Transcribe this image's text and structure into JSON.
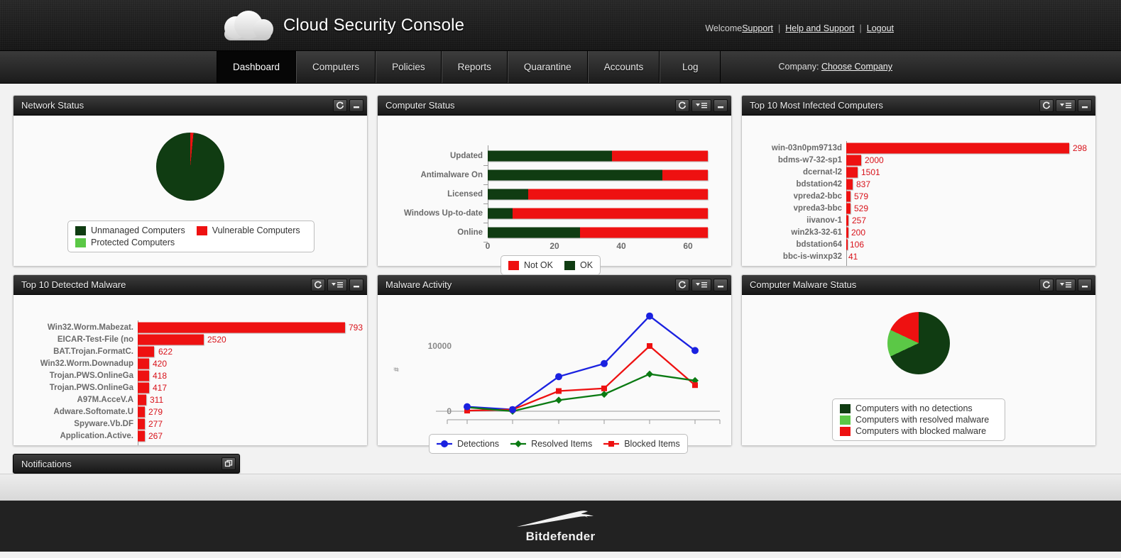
{
  "header": {
    "app_title": "Cloud Security Console",
    "logo_icon": "cloud-icon",
    "welcome_text": "Welcome",
    "user_link": "Support",
    "help_link": "Help and Support",
    "logout_link": "Logout",
    "separator": "|"
  },
  "nav": {
    "tabs": [
      {
        "label": "Dashboard",
        "active": true
      },
      {
        "label": "Computers",
        "active": false
      },
      {
        "label": "Policies",
        "active": false
      },
      {
        "label": "Reports",
        "active": false
      },
      {
        "label": "Quarantine",
        "active": false
      },
      {
        "label": "Accounts",
        "active": false
      },
      {
        "label": "Log",
        "active": false
      }
    ],
    "company_label": "Company:",
    "company_link": "Choose Company"
  },
  "panel_controls": {
    "refresh": "refresh-icon",
    "menu": "dropdown-menu-icon",
    "minimize": "minimize-icon",
    "maximize": "maximize-icon"
  },
  "colors": {
    "dark_green": "#103c12",
    "light_green": "#5bc846",
    "red": "#ee1111",
    "blue": "#1a21e0",
    "green_line": "#0a7a12",
    "axis": "#9a9a9a"
  },
  "panels": {
    "network_status": {
      "title": "Network Status"
    },
    "computer_status": {
      "title": "Computer Status"
    },
    "top_infected": {
      "title": "Top 10 Most Infected Computers"
    },
    "top_malware": {
      "title": "Top 10 Detected Malware"
    },
    "malware_activity": {
      "title": "Malware Activity"
    },
    "computer_malware_status": {
      "title": "Computer Malware Status"
    }
  },
  "notifications": {
    "title": "Notifications",
    "icon": "restore-window-icon"
  },
  "footer": {
    "brand": "Bitdefender",
    "mark": "bitdefender-wolf-icon"
  },
  "chart_data": [
    {
      "id": "network_status",
      "type": "pie",
      "title": "Network Status",
      "labels": [
        "Unmanaged Computers",
        "Vulnerable Computers",
        "Protected Computers"
      ],
      "values": [
        98.5,
        1.5,
        0
      ],
      "colors": [
        "#103c12",
        "#ee1111",
        "#5bc846"
      ],
      "legend": "bottom"
    },
    {
      "id": "computer_status",
      "type": "bar",
      "orientation": "horizontal",
      "stacked": true,
      "title": "Computer Status",
      "categories": [
        "Updated",
        "Antimalware On",
        "Licensed",
        "Windows Up-to-date",
        "Online"
      ],
      "series": [
        {
          "name": "OK",
          "color": "#103c12",
          "values": [
            37,
            52,
            12,
            7.5,
            27.5
          ]
        },
        {
          "name": "Not OK",
          "color": "#ee1111",
          "values": [
            28.6,
            13.6,
            53.6,
            58.1,
            38.1
          ]
        }
      ],
      "xticks": [
        "0",
        "20",
        "40",
        "60"
      ],
      "xtick_values": [
        0,
        20,
        40,
        60
      ],
      "xlim": [
        0,
        65.6
      ],
      "legend": [
        "Not OK",
        "OK"
      ],
      "legend_position": "bottom",
      "grid": false
    },
    {
      "id": "top_infected",
      "type": "bar",
      "orientation": "horizontal",
      "title": "Top 10 Most Infected Computers",
      "categories": [
        "win-03n0pm9713d",
        "bdms-w7-32-sp1",
        "dcernat-l2",
        "bdstation42",
        "vpreda2-bbc",
        "vpreda3-bbc",
        "iivanov-1",
        "win2k3-32-61",
        "bdstation64",
        "bbc-is-winxp32"
      ],
      "values": [
        29800,
        2000,
        1501,
        837,
        579,
        529,
        257,
        200,
        106,
        41
      ],
      "labels": [
        "298",
        "2000",
        "1501",
        "837",
        "579",
        "529",
        "257",
        "200",
        "106",
        "41"
      ],
      "xticks": [
        "0k",
        "5k",
        "10k",
        "15k",
        "20k",
        "25k",
        "30k"
      ],
      "xtick_values": [
        0,
        5000,
        10000,
        15000,
        20000,
        25000,
        30000
      ],
      "xlim": [
        0,
        32500
      ],
      "color": "#ee1111",
      "grid": false
    },
    {
      "id": "top_malware",
      "type": "bar",
      "orientation": "horizontal",
      "title": "Top 10 Detected Malware",
      "categories": [
        "Win32.Worm.Mabezat.",
        "EICAR-Test-File (no",
        "BAT.Trojan.FormatC.",
        "Win32.Worm.Downadup",
        "Trojan.PWS.OnlineGa",
        "Trojan.PWS.OnlineGa",
        "A97M.AcceV.A",
        "Adware.Softomate.U",
        "Spyware.Vb.DF",
        "Application.Active."
      ],
      "values": [
        7930,
        2520,
        622,
        420,
        418,
        417,
        311,
        279,
        277,
        267
      ],
      "labels": [
        "793",
        "2520",
        "622",
        "420",
        "418",
        "417",
        "311",
        "279",
        "277",
        "267"
      ],
      "xticks": [
        "0k",
        "2k",
        "4k",
        "6k",
        "8k"
      ],
      "xtick_values": [
        0,
        2000,
        4000,
        6000,
        8000
      ],
      "xlim": [
        0,
        8600
      ],
      "color": "#ee1111",
      "grid": false
    },
    {
      "id": "malware_activity",
      "type": "line",
      "title": "Malware Activity",
      "ylabel": "#",
      "yticks": [
        "0",
        "10000"
      ],
      "ytick_values": [
        0,
        10000
      ],
      "ylim": [
        0,
        16000
      ],
      "x": [
        1,
        2,
        3,
        4,
        5,
        6
      ],
      "series": [
        {
          "name": "Detections",
          "color": "#1a21e0",
          "marker": "circle",
          "values": [
            700,
            250,
            5300,
            7300,
            14600,
            9300
          ]
        },
        {
          "name": "Blocked Items",
          "color": "#ee1111",
          "marker": "square",
          "values": [
            100,
            250,
            3100,
            3500,
            10000,
            4000
          ]
        },
        {
          "name": "Resolved Items",
          "color": "#0a7a12",
          "marker": "diamond",
          "values": [
            600,
            0,
            1700,
            2600,
            5700,
            4700
          ]
        }
      ],
      "legend": [
        "Detections",
        "Resolved Items",
        "Blocked Items"
      ],
      "legend_position": "bottom",
      "grid": false
    },
    {
      "id": "computer_malware_status",
      "type": "pie",
      "title": "Computer Malware Status",
      "labels": [
        "Computers with no detections",
        "Computers with resolved malware",
        "Computers with blocked malware"
      ],
      "values": [
        68,
        14,
        18
      ],
      "colors": [
        "#103c12",
        "#5bc846",
        "#ee1111"
      ],
      "legend": "bottom"
    }
  ]
}
